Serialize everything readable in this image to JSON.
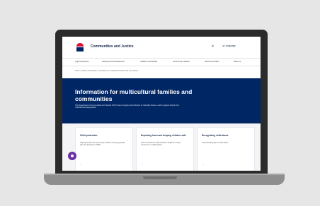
{
  "site": {
    "title": "Communities and Justice",
    "language": "Language",
    "logo_text": "NSW"
  },
  "nav": {
    "items": [
      "Legal and justice",
      "Housing and homelessness",
      "Children and families",
      "Community inclusion",
      "Service providers",
      "About us"
    ]
  },
  "breadcrumb": "Home  ›  Children and families  ›  Information for multicultural families and communities",
  "hero": {
    "title": "Information for multicultural families and communities",
    "description": "The Department of Communities and Justice (DCJ) has an ongoing commitment to culturally diverse, and to support clients from multicultural backgrounds."
  },
  "cards": [
    {
      "title": "Child protection",
      "body": "Helping families and carers keep children and young people safe and protected in NSW.",
      "arrow": "→"
    },
    {
      "title": "Reporting harm and keeping children safe",
      "body": "How to contact the Child Protection Helpline to report concerns for a child's safety.",
      "arrow": "→"
    },
    {
      "title": "Recognising child abuse",
      "body": "Understanding signs of child abuse.",
      "arrow": "→"
    }
  ],
  "colors": {
    "hero_bg": "#002664",
    "accent_red": "#d7153a",
    "chat_button": "#6b2fa6"
  }
}
